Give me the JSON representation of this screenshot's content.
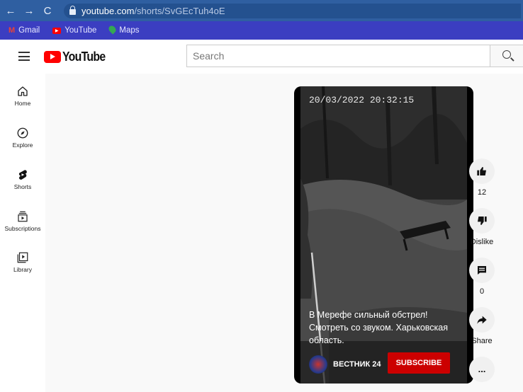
{
  "browser": {
    "back": "←",
    "forward": "→",
    "reload": "C",
    "url_host": "youtube.com",
    "url_path": "/shorts/SvGEcTuh4oE",
    "bookmarks": [
      {
        "label": "Gmail",
        "icon": "gmail-icon"
      },
      {
        "label": "YouTube",
        "icon": "youtube-icon"
      },
      {
        "label": "Maps",
        "icon": "maps-icon"
      }
    ]
  },
  "header": {
    "logo_text": "YouTube",
    "search_placeholder": "Search"
  },
  "sidebar": {
    "items": [
      {
        "label": "Home",
        "icon": "home-icon"
      },
      {
        "label": "Explore",
        "icon": "compass-icon"
      },
      {
        "label": "Shorts",
        "icon": "shorts-icon"
      },
      {
        "label": "Subscriptions",
        "icon": "subscriptions-icon"
      },
      {
        "label": "Library",
        "icon": "library-icon"
      }
    ]
  },
  "video": {
    "timestamp": "20/03/2022 20:32:15",
    "caption": "В Мерефе сильный обстрел! Смотреть со звуком. Харьковская область.",
    "channel_name": "ВЕСТНИК 24",
    "subscribe_label": "SUBSCRIBE"
  },
  "actions": {
    "like_count": "12",
    "dislike_label": "Dislike",
    "comment_count": "0",
    "share_label": "Share",
    "more_label": "..."
  },
  "colors": {
    "browser_bar": "#2f5fa1",
    "bookmarks_bar": "#3b3ec1",
    "brand_red": "#ff0000",
    "subscribe_red": "#cc0000"
  }
}
